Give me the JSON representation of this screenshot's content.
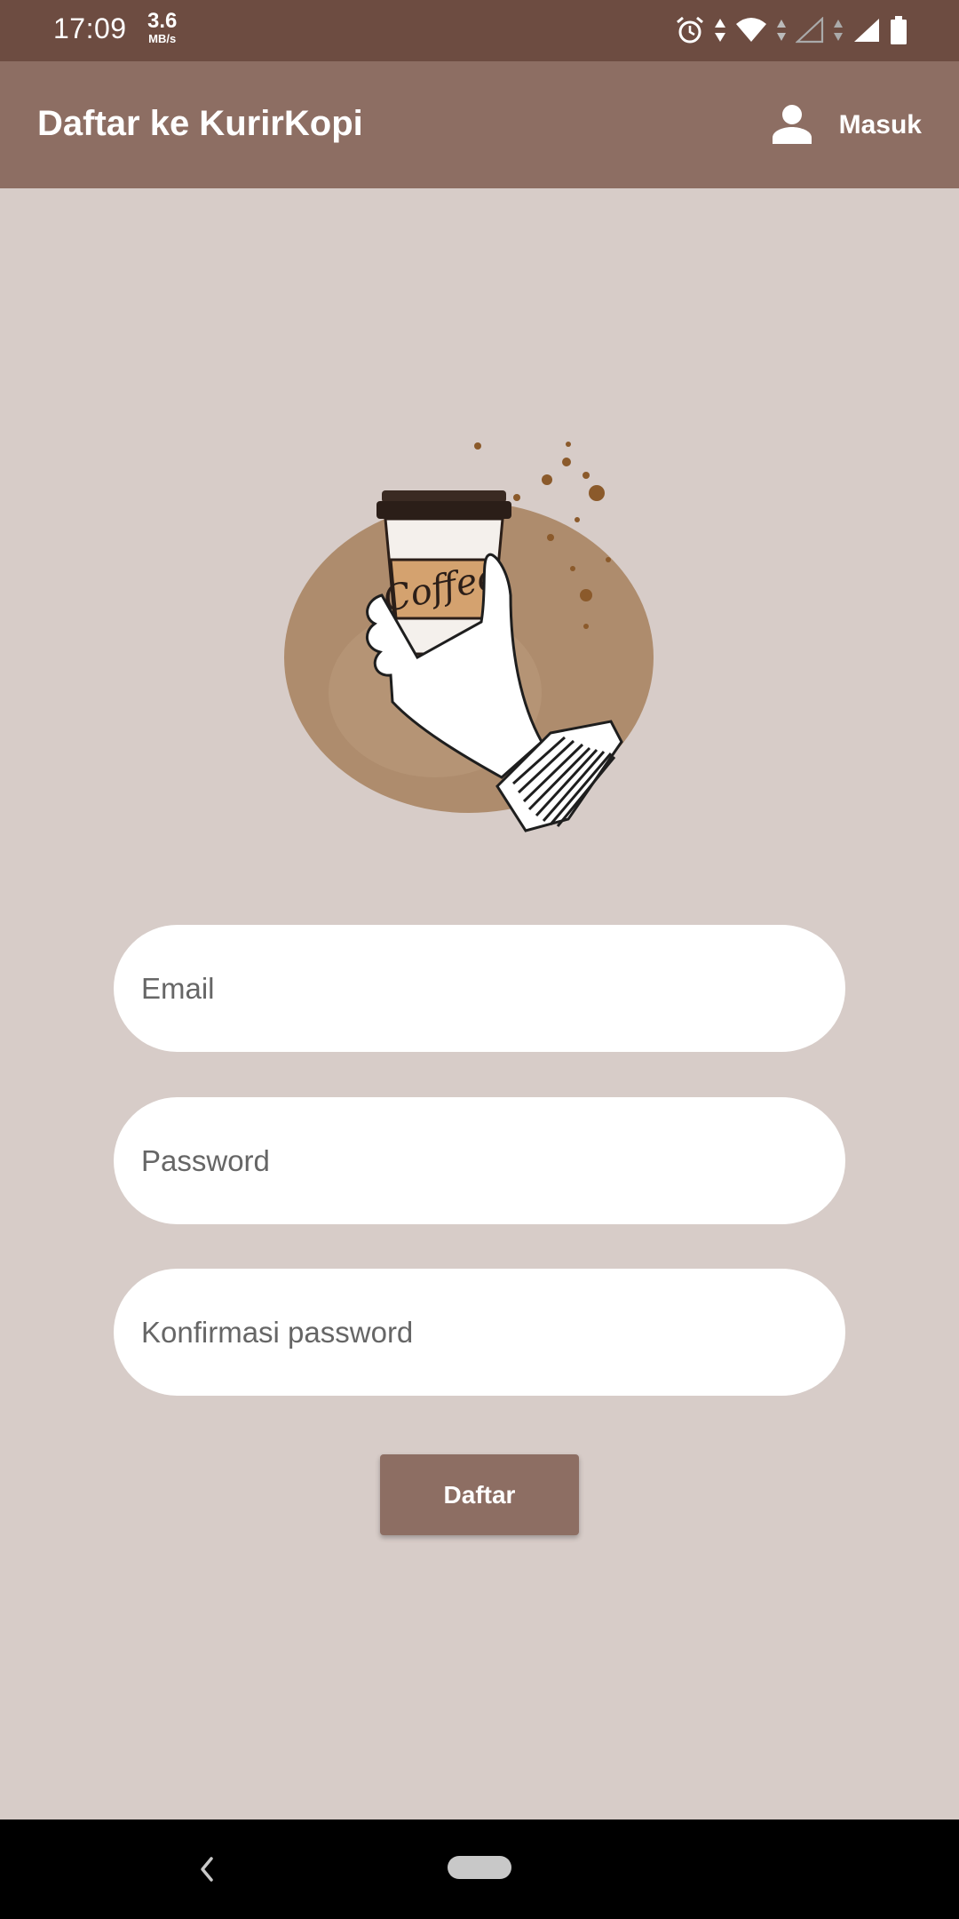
{
  "status_bar": {
    "time": "17:09",
    "net_speed_value": "3.6",
    "net_speed_unit": "MB/s",
    "icons": [
      "alarm-icon",
      "data-arrows-icon",
      "wifi-icon",
      "mobile-signal-empty-icon",
      "signal-icon",
      "battery-icon"
    ]
  },
  "app_bar": {
    "title": "Daftar ke KurirKopi",
    "login_icon": "person-icon",
    "login_label": "Masuk"
  },
  "illustration": {
    "cup_text": "Coffee"
  },
  "form": {
    "email_placeholder": "Email",
    "email_value": "",
    "password_placeholder": "Password",
    "password_value": "",
    "confirm_placeholder": "Konfirmasi password",
    "confirm_value": "",
    "submit_label": "Daftar"
  },
  "nav_bar": {
    "icons": [
      "back-icon",
      "home-pill-icon"
    ]
  },
  "colors": {
    "status_bar": "#6d4c41",
    "app_bar": "#8d6e63",
    "background": "#d7ccc8",
    "button": "#8d6e63",
    "field": "#ffffff"
  }
}
